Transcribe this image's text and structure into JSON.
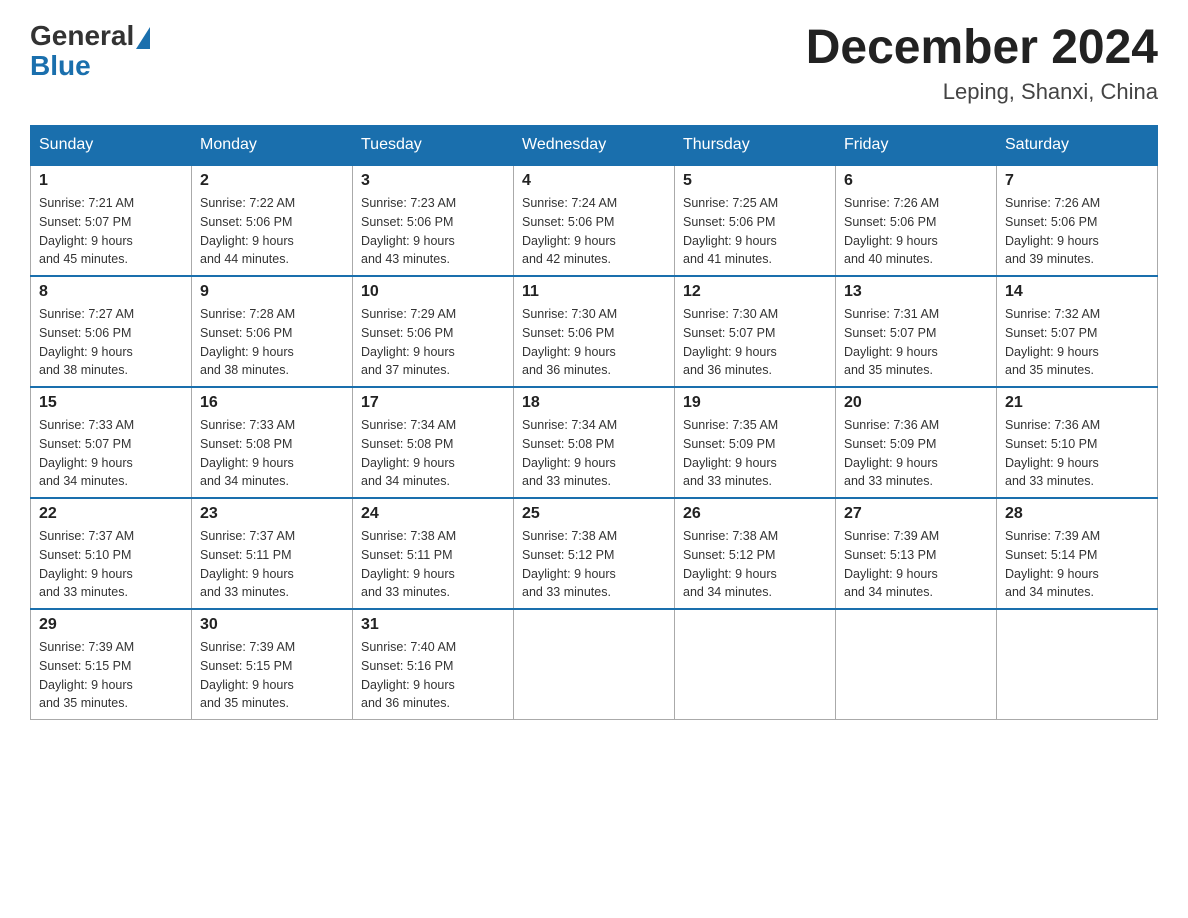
{
  "header": {
    "logo_general": "General",
    "logo_blue": "Blue",
    "month_title": "December 2024",
    "location": "Leping, Shanxi, China"
  },
  "days_of_week": [
    "Sunday",
    "Monday",
    "Tuesday",
    "Wednesday",
    "Thursday",
    "Friday",
    "Saturday"
  ],
  "weeks": [
    [
      {
        "day": "1",
        "sunrise": "7:21 AM",
        "sunset": "5:07 PM",
        "daylight": "9 hours and 45 minutes."
      },
      {
        "day": "2",
        "sunrise": "7:22 AM",
        "sunset": "5:06 PM",
        "daylight": "9 hours and 44 minutes."
      },
      {
        "day": "3",
        "sunrise": "7:23 AM",
        "sunset": "5:06 PM",
        "daylight": "9 hours and 43 minutes."
      },
      {
        "day": "4",
        "sunrise": "7:24 AM",
        "sunset": "5:06 PM",
        "daylight": "9 hours and 42 minutes."
      },
      {
        "day": "5",
        "sunrise": "7:25 AM",
        "sunset": "5:06 PM",
        "daylight": "9 hours and 41 minutes."
      },
      {
        "day": "6",
        "sunrise": "7:26 AM",
        "sunset": "5:06 PM",
        "daylight": "9 hours and 40 minutes."
      },
      {
        "day": "7",
        "sunrise": "7:26 AM",
        "sunset": "5:06 PM",
        "daylight": "9 hours and 39 minutes."
      }
    ],
    [
      {
        "day": "8",
        "sunrise": "7:27 AM",
        "sunset": "5:06 PM",
        "daylight": "9 hours and 38 minutes."
      },
      {
        "day": "9",
        "sunrise": "7:28 AM",
        "sunset": "5:06 PM",
        "daylight": "9 hours and 38 minutes."
      },
      {
        "day": "10",
        "sunrise": "7:29 AM",
        "sunset": "5:06 PM",
        "daylight": "9 hours and 37 minutes."
      },
      {
        "day": "11",
        "sunrise": "7:30 AM",
        "sunset": "5:06 PM",
        "daylight": "9 hours and 36 minutes."
      },
      {
        "day": "12",
        "sunrise": "7:30 AM",
        "sunset": "5:07 PM",
        "daylight": "9 hours and 36 minutes."
      },
      {
        "day": "13",
        "sunrise": "7:31 AM",
        "sunset": "5:07 PM",
        "daylight": "9 hours and 35 minutes."
      },
      {
        "day": "14",
        "sunrise": "7:32 AM",
        "sunset": "5:07 PM",
        "daylight": "9 hours and 35 minutes."
      }
    ],
    [
      {
        "day": "15",
        "sunrise": "7:33 AM",
        "sunset": "5:07 PM",
        "daylight": "9 hours and 34 minutes."
      },
      {
        "day": "16",
        "sunrise": "7:33 AM",
        "sunset": "5:08 PM",
        "daylight": "9 hours and 34 minutes."
      },
      {
        "day": "17",
        "sunrise": "7:34 AM",
        "sunset": "5:08 PM",
        "daylight": "9 hours and 34 minutes."
      },
      {
        "day": "18",
        "sunrise": "7:34 AM",
        "sunset": "5:08 PM",
        "daylight": "9 hours and 33 minutes."
      },
      {
        "day": "19",
        "sunrise": "7:35 AM",
        "sunset": "5:09 PM",
        "daylight": "9 hours and 33 minutes."
      },
      {
        "day": "20",
        "sunrise": "7:36 AM",
        "sunset": "5:09 PM",
        "daylight": "9 hours and 33 minutes."
      },
      {
        "day": "21",
        "sunrise": "7:36 AM",
        "sunset": "5:10 PM",
        "daylight": "9 hours and 33 minutes."
      }
    ],
    [
      {
        "day": "22",
        "sunrise": "7:37 AM",
        "sunset": "5:10 PM",
        "daylight": "9 hours and 33 minutes."
      },
      {
        "day": "23",
        "sunrise": "7:37 AM",
        "sunset": "5:11 PM",
        "daylight": "9 hours and 33 minutes."
      },
      {
        "day": "24",
        "sunrise": "7:38 AM",
        "sunset": "5:11 PM",
        "daylight": "9 hours and 33 minutes."
      },
      {
        "day": "25",
        "sunrise": "7:38 AM",
        "sunset": "5:12 PM",
        "daylight": "9 hours and 33 minutes."
      },
      {
        "day": "26",
        "sunrise": "7:38 AM",
        "sunset": "5:12 PM",
        "daylight": "9 hours and 34 minutes."
      },
      {
        "day": "27",
        "sunrise": "7:39 AM",
        "sunset": "5:13 PM",
        "daylight": "9 hours and 34 minutes."
      },
      {
        "day": "28",
        "sunrise": "7:39 AM",
        "sunset": "5:14 PM",
        "daylight": "9 hours and 34 minutes."
      }
    ],
    [
      {
        "day": "29",
        "sunrise": "7:39 AM",
        "sunset": "5:15 PM",
        "daylight": "9 hours and 35 minutes."
      },
      {
        "day": "30",
        "sunrise": "7:39 AM",
        "sunset": "5:15 PM",
        "daylight": "9 hours and 35 minutes."
      },
      {
        "day": "31",
        "sunrise": "7:40 AM",
        "sunset": "5:16 PM",
        "daylight": "9 hours and 36 minutes."
      },
      null,
      null,
      null,
      null
    ]
  ],
  "labels": {
    "sunrise_prefix": "Sunrise: ",
    "sunset_prefix": "Sunset: ",
    "daylight_prefix": "Daylight: "
  }
}
